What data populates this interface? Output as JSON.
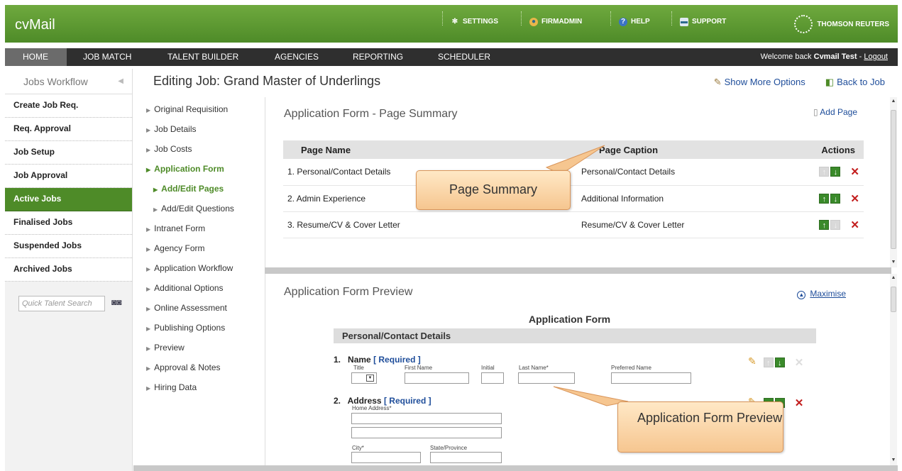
{
  "app": {
    "logo": "cvMail",
    "brand": "THOMSON REUTERS"
  },
  "top_links": [
    {
      "label": "SETTINGS",
      "icon": "gear-icon"
    },
    {
      "label": "FIRMADMIN",
      "icon": "admin-user-icon"
    },
    {
      "label": "HELP",
      "icon": "help-icon"
    },
    {
      "label": "SUPPORT",
      "icon": "chat-icon"
    }
  ],
  "nav": {
    "items": [
      "HOME",
      "JOB MATCH",
      "TALENT BUILDER",
      "AGENCIES",
      "REPORTING",
      "SCHEDULER"
    ],
    "welcome_prefix": "Welcome back",
    "user": "Cvmail Test",
    "logout": "Logout"
  },
  "sidebar": {
    "title": "Jobs Workflow",
    "items": [
      "Create Job Req.",
      "Req. Approval",
      "Job Setup",
      "Job Approval",
      "Active Jobs",
      "Finalised Jobs",
      "Suspended Jobs",
      "Archived Jobs"
    ],
    "active": "Active Jobs",
    "search_placeholder": "Quick Talent Search"
  },
  "page": {
    "title": "Editing Job: Grand Master of Underlings",
    "show_more": "Show More Options",
    "back": "Back to Job"
  },
  "job_nav": [
    "Original Requisition",
    "Job Details",
    "Job Costs",
    "Application Form",
    "Add/Edit Pages",
    "Add/Edit Questions",
    "Intranet Form",
    "Agency Form",
    "Application Workflow",
    "Additional Options",
    "Online Assessment",
    "Publishing Options",
    "Preview",
    "Approval & Notes",
    "Hiring Data"
  ],
  "summary": {
    "title": "Application Form - Page Summary",
    "add_page": "Add Page",
    "columns": [
      "Page Name",
      "Page Caption",
      "Actions"
    ],
    "rows": [
      {
        "num": "1.",
        "name": "Personal/Contact Details",
        "caption": "Personal/Contact Details"
      },
      {
        "num": "2.",
        "name": "Admin Experience",
        "caption": "Additional Information"
      },
      {
        "num": "3.",
        "name": "Resume/CV & Cover Letter",
        "caption": "Resume/CV & Cover Letter"
      }
    ]
  },
  "preview": {
    "title": "Application Form Preview",
    "maximise": "Maximise",
    "form_title": "Application Form",
    "section": "Personal/Contact Details",
    "q1": {
      "num": "1.",
      "label": "Name",
      "req": "[ Required ]",
      "fields": [
        "Title",
        "First Name",
        "Initial",
        "Last Name*",
        "Preferred Name"
      ]
    },
    "q2": {
      "num": "2.",
      "label": "Address",
      "req": "[ Required ]",
      "fields": [
        "Home Address*",
        "City*",
        "State/Province"
      ]
    }
  },
  "callouts": {
    "summary": "Page Summary",
    "preview": "Application Form Preview"
  }
}
